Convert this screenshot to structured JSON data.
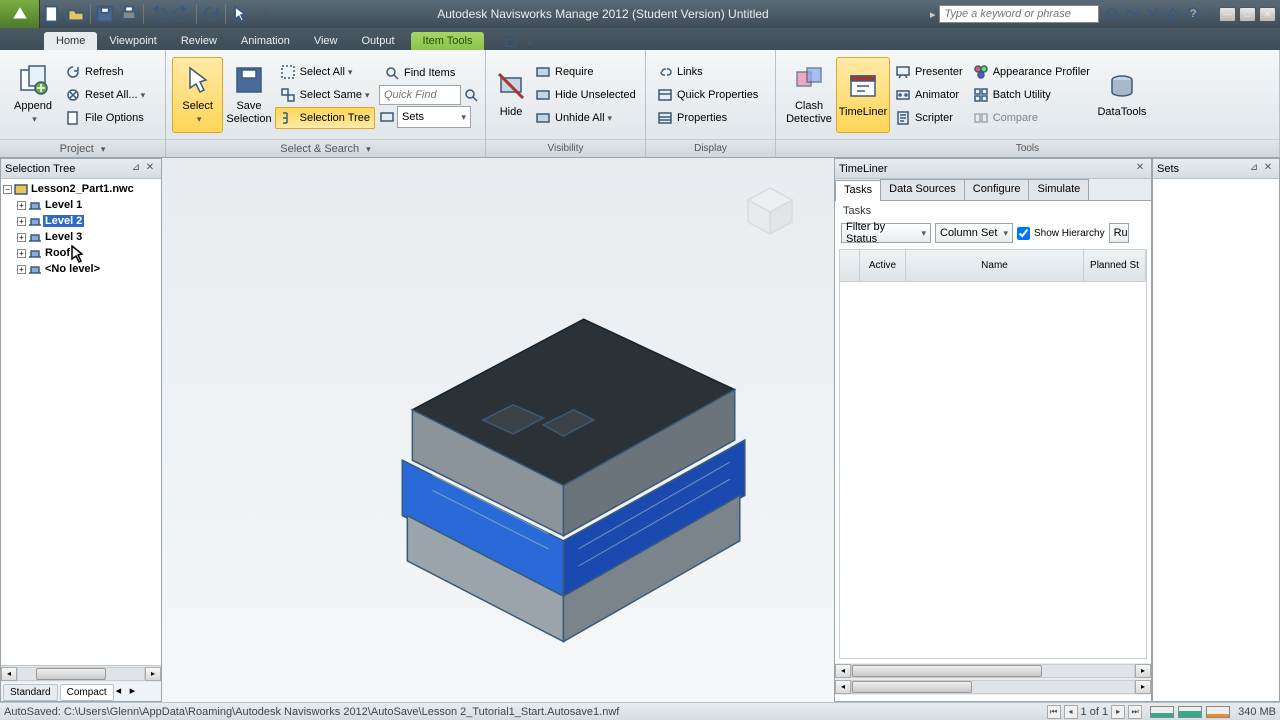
{
  "title": "Autodesk Navisworks Manage 2012 (Student Version)    Untitled",
  "search_placeholder": "Type a keyword or phrase",
  "tabs": {
    "home": "Home",
    "viewpoint": "Viewpoint",
    "review": "Review",
    "animation": "Animation",
    "view": "View",
    "output": "Output",
    "item_tools": "Item Tools"
  },
  "ribbon": {
    "project": {
      "append": "Append",
      "refresh": "Refresh",
      "reset_all": "Reset All...",
      "file_options": "File Options",
      "label": "Project"
    },
    "select": {
      "select": "Select",
      "save_selection": "Save Selection",
      "select_all": "Select All",
      "select_same": "Select Same",
      "selection_tree": "Selection Tree",
      "find_items": "Find Items",
      "quick_find": "Quick Find",
      "sets": "Sets",
      "label": "Select & Search"
    },
    "visibility": {
      "hide": "Hide",
      "require": "Require",
      "hide_unselected": "Hide Unselected",
      "unhide_all": "Unhide All",
      "label": "Visibility"
    },
    "display": {
      "links": "Links",
      "quick_properties": "Quick Properties",
      "properties": "Properties",
      "label": "Display"
    },
    "tools": {
      "clash": "Clash Detective",
      "timeliner": "TimeLiner",
      "presenter": "Presenter",
      "animator": "Animator",
      "scripter": "Scripter",
      "appearance_profiler": "Appearance Profiler",
      "batch_utility": "Batch Utility",
      "compare": "Compare",
      "datatools": "DataTools",
      "label": "Tools"
    }
  },
  "seltree": {
    "title": "Selection Tree",
    "root": "Lesson2_Part1.nwc",
    "nodes": [
      "Level 1",
      "Level 2",
      "Level 3",
      "Roof",
      "<No level>"
    ],
    "tab_standard": "Standard",
    "tab_compact": "Compact"
  },
  "timeliner": {
    "title": "TimeLiner",
    "tabs": {
      "tasks": "Tasks",
      "data_sources": "Data Sources",
      "configure": "Configure",
      "simulate": "Simulate"
    },
    "subtitle": "Tasks",
    "filter": "Filter by Status",
    "column_set": "Column Set",
    "show_hierarchy": "Show Hierarchy",
    "rules": "Ru",
    "cols": {
      "active": "Active",
      "name": "Name",
      "planned": "Planned St"
    }
  },
  "sets": {
    "title": "Sets"
  },
  "status": {
    "text": "AutoSaved: C:\\Users\\Glenn\\AppData\\Roaming\\Autodesk Navisworks 2012\\AutoSave\\Lesson 2_Tutorial1_Start.Autosave1.nwf",
    "page": "1 of 1",
    "mem": "340 MB"
  }
}
